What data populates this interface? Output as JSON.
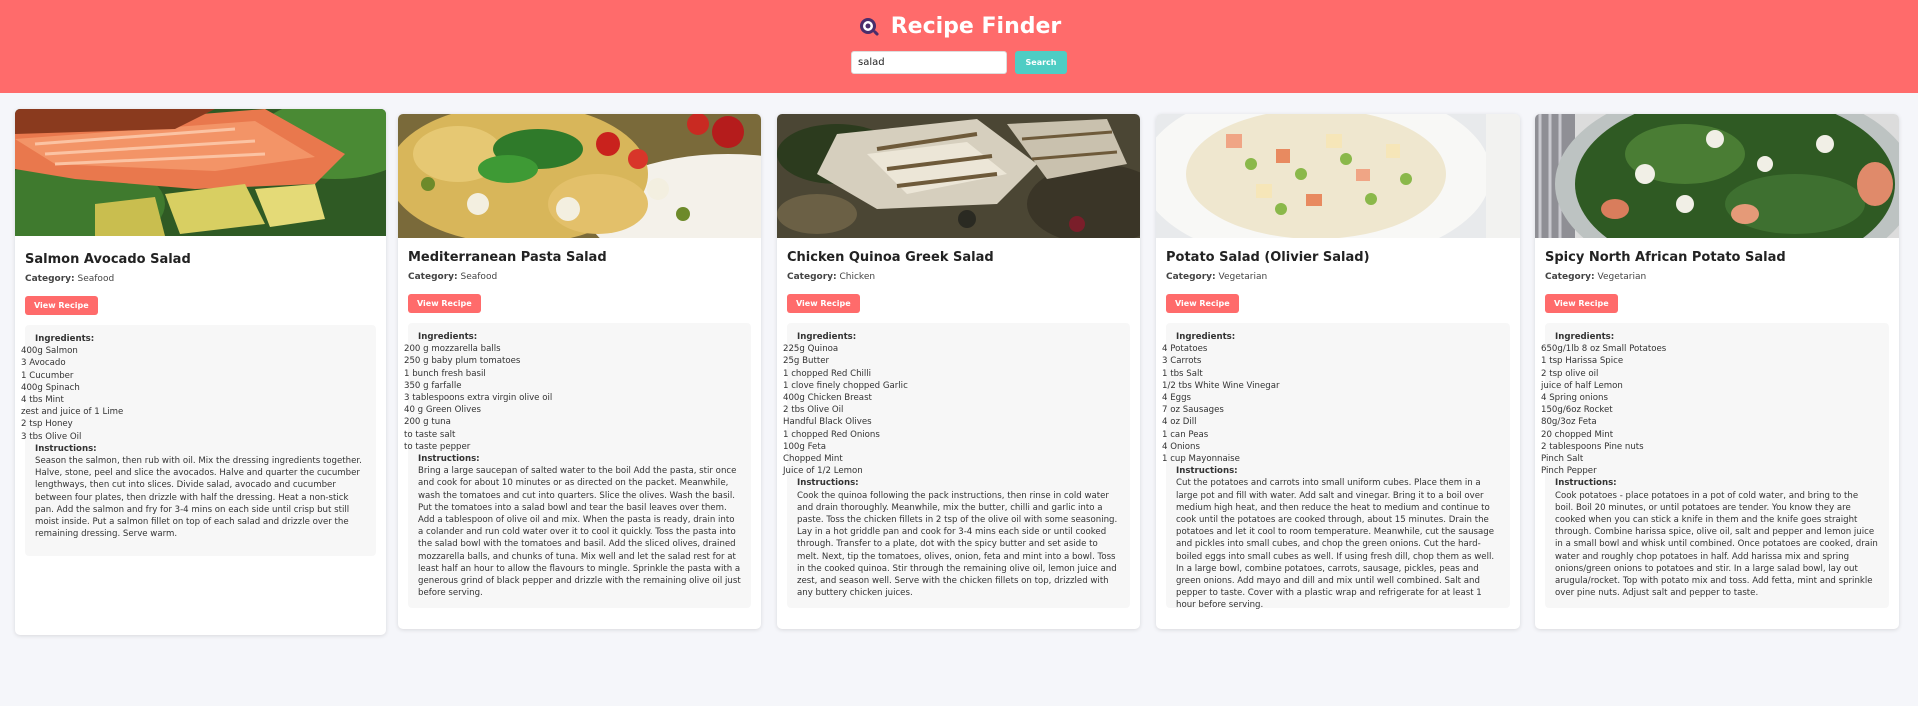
{
  "header": {
    "title": "Recipe Finder",
    "icon": "search-icon",
    "bg_color": "#ff6b6b"
  },
  "search": {
    "value": "salad",
    "button_label": "Search",
    "button_color": "#4ecdc4"
  },
  "labels": {
    "category": "Category:",
    "view_recipe": "View Recipe",
    "ingredients": "Ingredients:",
    "instructions": "Instructions:"
  },
  "recipes": [
    {
      "title": "Salmon Avocado Salad",
      "category": "Seafood",
      "image": "salmon-avocado-photo",
      "ingredients": [
        "400g Salmon",
        "3 Avocado",
        "1 Cucumber",
        "400g Spinach",
        "4 tbs Mint",
        "zest and juice of 1 Lime",
        "2 tsp Honey",
        "3 tbs Olive Oil"
      ],
      "instructions": "Season the salmon, then rub with oil. Mix the dressing ingredients together. Halve, stone, peel and slice the avocados. Halve and quarter the cucumber lengthways, then cut into slices. Divide salad, avocado and cucumber between four plates, then drizzle with half the dressing. Heat a non-stick pan. Add the salmon and fry for 3-4 mins on each side until crisp but still moist inside. Put a salmon fillet on top of each salad and drizzle over the remaining dressing. Serve warm."
    },
    {
      "title": "Mediterranean Pasta Salad",
      "category": "Seafood",
      "image": "pasta-salad-photo",
      "ingredients": [
        "200 g mozzarella balls",
        "250 g baby plum tomatoes",
        "1 bunch fresh basil",
        "350 g farfalle",
        "3 tablespoons extra virgin olive oil",
        "40 g Green Olives",
        "200 g tuna",
        "to taste salt",
        "to taste pepper"
      ],
      "instructions": "Bring a large saucepan of salted water to the boil Add the pasta, stir once and cook for about 10 minutes or as directed on the packet. Meanwhile, wash the tomatoes and cut into quarters. Slice the olives. Wash the basil. Put the tomatoes into a salad bowl and tear the basil leaves over them. Add a tablespoon of olive oil and mix. When the pasta is ready, drain into a colander and run cold water over it to cool it quickly. Toss the pasta into the salad bowl with the tomatoes and basil. Add the sliced olives, drained mozzarella balls, and chunks of tuna. Mix well and let the salad rest for at least half an hour to allow the flavours to mingle. Sprinkle the pasta with a generous grind of black pepper and drizzle with the remaining olive oil just before serving."
    },
    {
      "title": "Chicken Quinoa Greek Salad",
      "category": "Chicken",
      "image": "chicken-quinoa-photo",
      "ingredients": [
        "225g Quinoa",
        "25g Butter",
        "1 chopped Red Chilli",
        "1 clove finely chopped Garlic",
        "400g Chicken Breast",
        "2 tbs Olive Oil",
        "Handful Black Olives",
        "1 chopped Red Onions",
        "100g Feta",
        "Chopped Mint",
        "Juice of 1/2 Lemon"
      ],
      "instructions": "Cook the quinoa following the pack instructions, then rinse in cold water and drain thoroughly. Meanwhile, mix the butter, chilli and garlic into a paste. Toss the chicken fillets in 2 tsp of the olive oil with some seasoning. Lay in a hot griddle pan and cook for 3-4 mins each side or until cooked through. Transfer to a plate, dot with the spicy butter and set aside to melt. Next, tip the tomatoes, olives, onion, feta and mint into a bowl. Toss in the cooked quinoa. Stir through the remaining olive oil, lemon juice and zest, and season well. Serve with the chicken fillets on top, drizzled with any buttery chicken juices."
    },
    {
      "title": "Potato Salad (Olivier Salad)",
      "category": "Vegetarian",
      "image": "potato-salad-photo",
      "ingredients": [
        "4 Potatoes",
        "3 Carrots",
        "1 tbs Salt",
        "1/2 tbs White Wine Vinegar",
        "4 Eggs",
        "7 oz Sausages",
        "4 oz Dill",
        "1 can Peas",
        "4 Onions",
        "1 cup Mayonnaise"
      ],
      "instructions": "Cut the potatoes and carrots into small uniform cubes. Place them in a large pot and fill with water. Add salt and vinegar. Bring it to a boil over medium high heat, and then reduce the heat to medium and continue to cook until the potatoes are cooked through, about 15 minutes. Drain the potatoes and let it cool to room temperature. Meanwhile, cut the sausage and pickles into small cubes, and chop the green onions. Cut the hard-boiled eggs into small cubes as well. If using fresh dill, chop them as well. In a large bowl, combine potatoes, carrots, sausage, pickles, peas and green onions. Add mayo and dill and mix until well combined. Salt and pepper to taste. Cover with a plastic wrap and refrigerate for at least 1 hour before serving."
    },
    {
      "title": "Spicy North African Potato Salad",
      "category": "Vegetarian",
      "image": "north-african-salad-photo",
      "ingredients": [
        "650g/1lb 8 oz Small Potatoes",
        "1 tsp Harissa Spice",
        "2 tsp olive oil",
        "juice of half Lemon",
        "4 Spring onions",
        "150g/6oz Rocket",
        "80g/3oz Feta",
        "20 chopped Mint",
        "2 tablespoons Pine nuts",
        "Pinch Salt",
        "Pinch Pepper"
      ],
      "instructions": "Cook potatoes - place potatoes in a pot of cold water, and bring to the boil. Boil 20 minutes, or until potatoes are tender. You know they are cooked when you can stick a knife in them and the knife goes straight through. Combine harissa spice, olive oil, salt and pepper and lemon juice in a small bowl and whisk until combined. Once potatoes are cooked, drain water and roughly chop potatoes in half. Add harissa mix and spring onions/green onions to potatoes and stir. In a large salad bowl, lay out arugula/rocket. Top with potato mix and toss. Add fetta, mint and sprinkle over pine nuts. Adjust salt and pepper to taste."
    }
  ]
}
